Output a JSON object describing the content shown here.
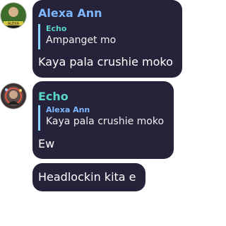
{
  "colors": {
    "bubble_bg": "#25223a",
    "alexa_name": "#7fb8ff",
    "echo_name": "#59d6c8",
    "reply_bar": "#8ad4ff"
  },
  "messages": [
    {
      "sender": "Alexa Ann",
      "avatar_text": "ALEXA",
      "reply_to": {
        "name": "Echo",
        "text": "Ampanget mo"
      },
      "text": "Kaya pala crushie moko"
    },
    {
      "sender": "Echo",
      "reply_to": {
        "name": "Alexa Ann",
        "text": "Kaya pala crushie moko"
      },
      "text": "Ew"
    },
    {
      "text": "Headlockin kita e"
    }
  ]
}
